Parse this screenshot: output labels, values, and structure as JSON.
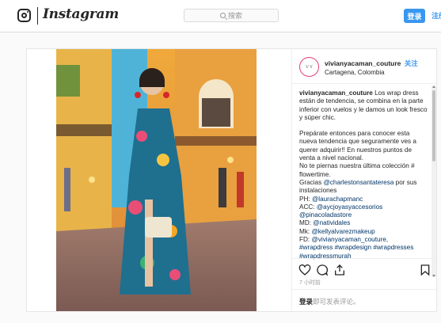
{
  "topbar": {
    "logo_text": "Instagram",
    "search_placeholder": "搜索",
    "login_label": "登录",
    "signup_label": "注册"
  },
  "post": {
    "username": "vivianyacaman_couture",
    "follow_label": "关注",
    "location": "Cartagena, Colombia",
    "caption_username": "vivianyacaman_couture",
    "caption_lines": [
      "Los wrap dress están de tendencia, se combina en la parte inferior con vuelos y le damos un look fresco y súper chic.",
      "Prepárate entonces para conocer esta nueva tendencia que seguramente ves a querer adquirir!! En nuestros puntos de venta a nivel nacional.",
      "No te piernas nuestra última colección # flowertime.",
      "Gracias"
    ],
    "mentions": [
      "@charlestonsantateresa",
      "@laurachapmanc",
      "@aycjoyasyaccesorios",
      "@pinacoladastore",
      "@natividales",
      "@kellyalvarezmakeup",
      "@vivianyacaman_couture",
      "#wrapdress",
      "#wrapdesign",
      "#wrapdresses",
      "#wrapdressmurah"
    ],
    "credit_suffix": "por sus instalaciones",
    "credit_labels": [
      "PH:",
      "ACC:",
      "MD:",
      "Mk:",
      "FD:"
    ],
    "time_ago": "7 小时前",
    "comment_login": "登录",
    "comment_prompt": "即可发表评论。"
  },
  "icons": {
    "like": "heart-icon",
    "comment": "comment-icon",
    "share": "share-icon",
    "save": "bookmark-icon"
  },
  "colors": {
    "accent": "#3897f0",
    "link": "#003569",
    "avatar_ring": "#e0407d"
  }
}
